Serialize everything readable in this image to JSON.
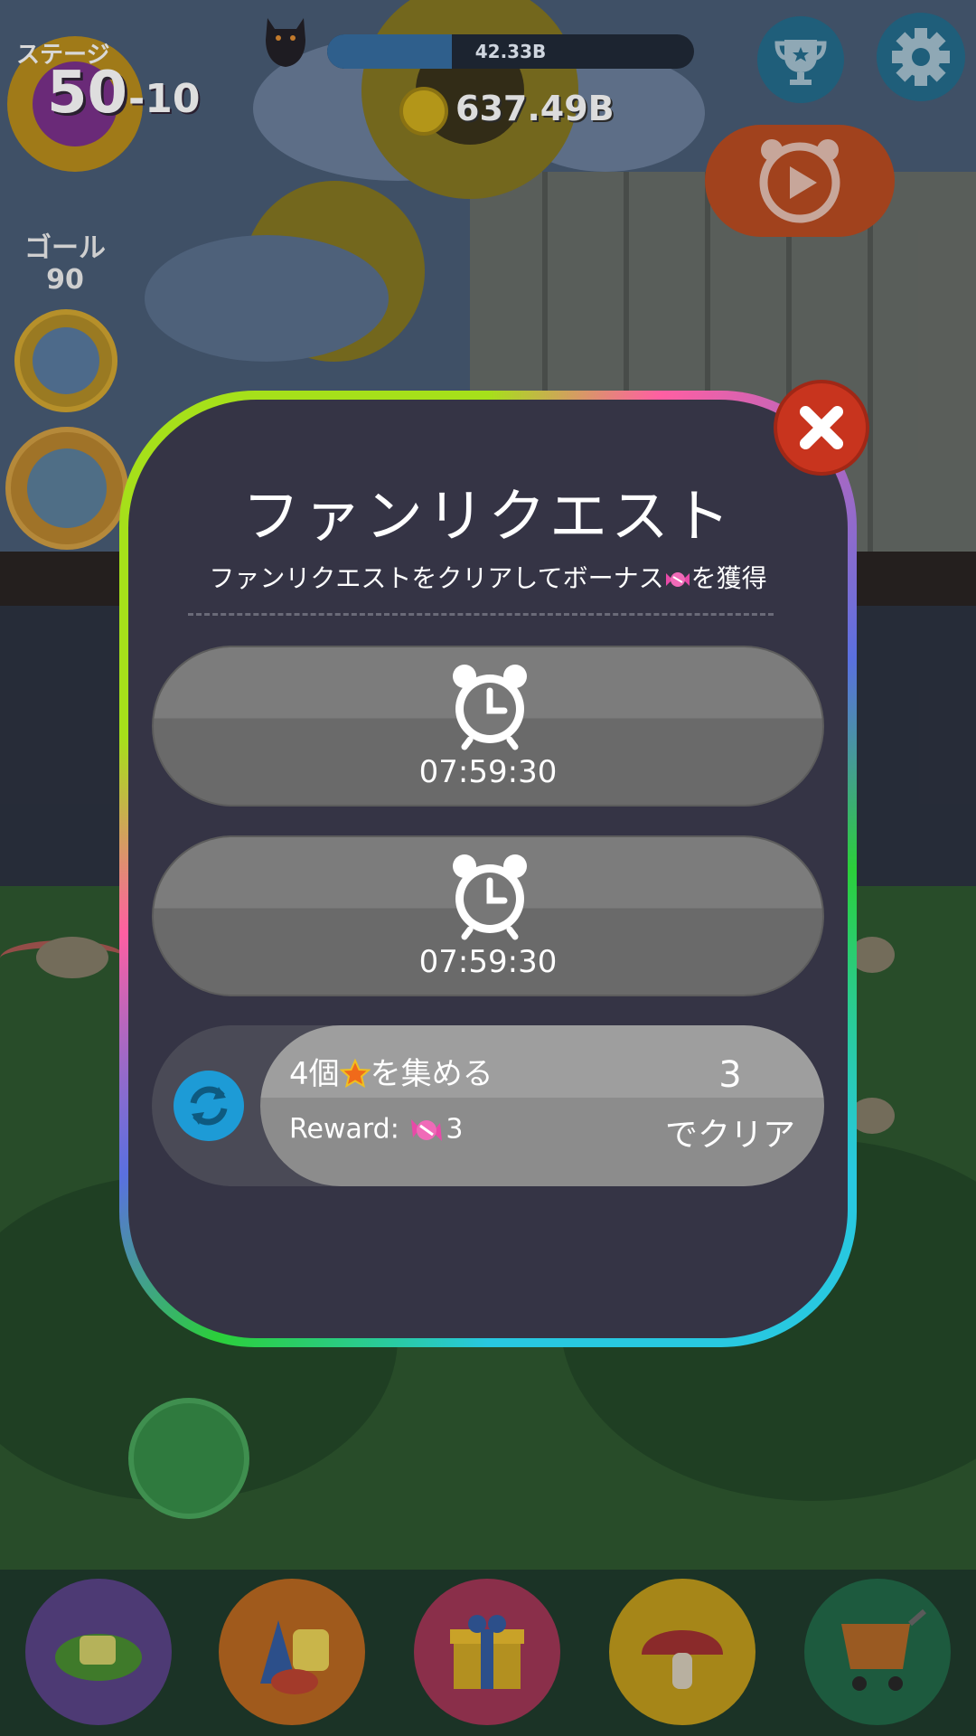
{
  "hud": {
    "stage_label": "ステージ",
    "stage_number": "50",
    "stage_sub": "-10",
    "progress_text": "42.33B",
    "progress_fraction": 0.34,
    "coins": "637.49B",
    "goal_label": "ゴール",
    "goal_value": "90"
  },
  "modal": {
    "title": "ファンリクエスト",
    "subtitle_before": "ファンリクエストをクリアしてボーナス",
    "subtitle_after": "を獲得",
    "timers": [
      "07:59:30",
      "07:59:30"
    ],
    "quest": {
      "title_prefix": "4個",
      "title_suffix": "を集める",
      "reward_label": "Reward:",
      "reward_amount": "3",
      "clear_count": "3",
      "clear_label": "でクリア"
    }
  },
  "icons": {
    "close": "close-icon",
    "clock": "alarm-clock-icon",
    "refresh": "refresh-icon",
    "candy": "candy-icon",
    "star": "star-icon",
    "trophy": "trophy-icon",
    "gear": "gear-icon"
  },
  "colors": {
    "modal_bg": "#353445",
    "close": "#c8341e",
    "refresh": "#1d9bd6"
  }
}
